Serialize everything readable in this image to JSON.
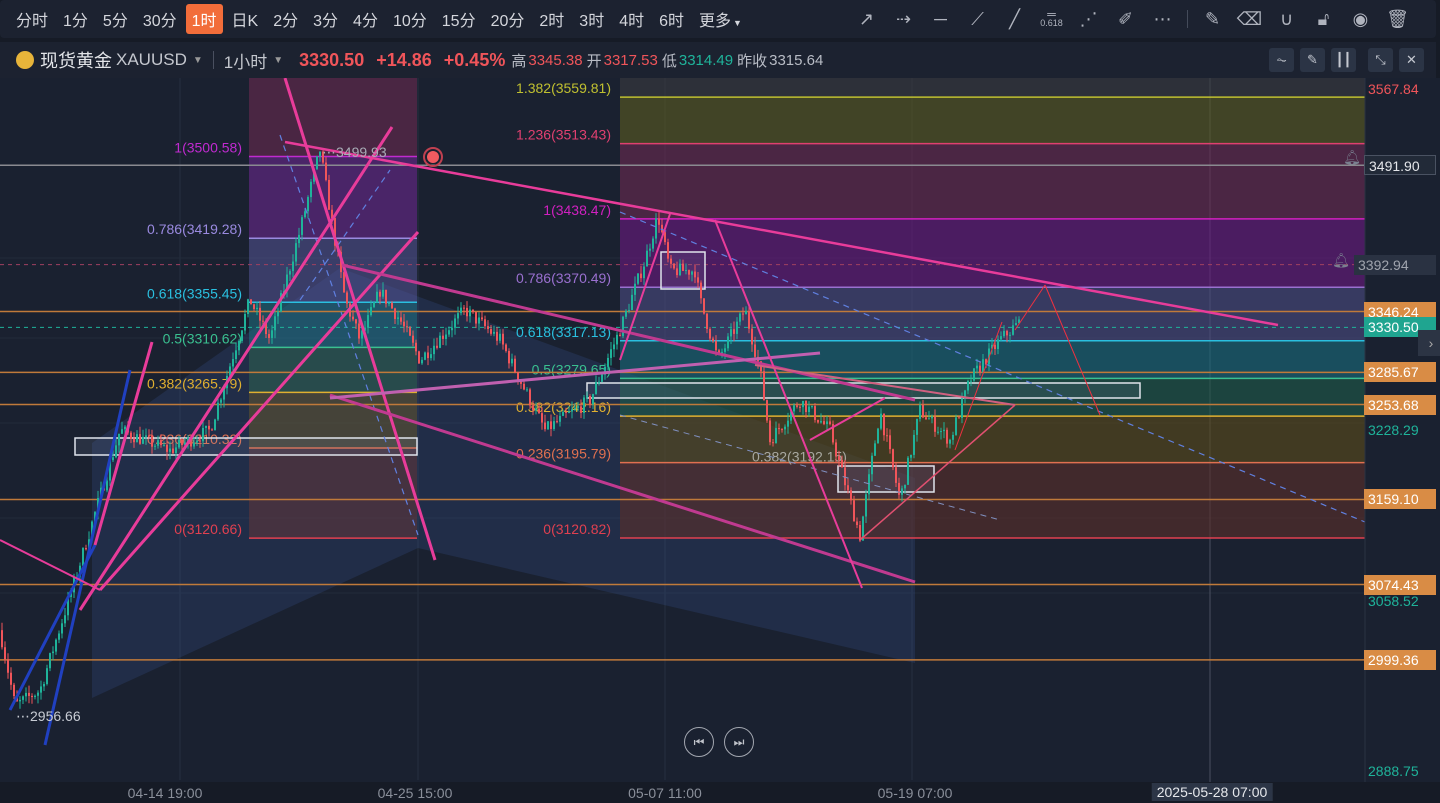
{
  "periods": [
    "分时",
    "1分",
    "5分",
    "30分",
    "1时",
    "日K",
    "2分",
    "3分",
    "4分",
    "10分",
    "15分",
    "20分",
    "2时",
    "3时",
    "4时",
    "6时",
    "更多"
  ],
  "active_period": "1时",
  "tools": [
    "trend-arrow",
    "dashed-arrow",
    "horizontal-line",
    "ray",
    "segment",
    "fib-0.618",
    "fan",
    "highlighter",
    "more",
    "edit",
    "eraser",
    "magnet",
    "unlock",
    "visibility",
    "trash"
  ],
  "fib_tool_label": "0.618",
  "symbol": {
    "name": "现货黄金",
    "code": "XAUUSD",
    "interval": "1小时",
    "price": "3330.50",
    "change": "+14.86",
    "change_pct": "+0.45%",
    "high_label": "高",
    "high": "3345.38",
    "open_label": "开",
    "open": "3317.53",
    "low_label": "低",
    "low": "3314.49",
    "prev_label": "昨收",
    "prev": "3315.64"
  },
  "colors": {
    "up": "#1fb39a",
    "down": "#f0555a",
    "accent": "#f26d3a",
    "level": "#d98c45"
  },
  "chart_data": {
    "type": "candlestick",
    "price_axis": [
      {
        "v": "3567.84",
        "p": 3567.84,
        "style": "red"
      },
      {
        "v": "3491.90",
        "p": 3491.9,
        "style": "alert"
      },
      {
        "v": "3392.94",
        "p": 3392.94,
        "style": "alert-gray"
      },
      {
        "v": "3346.24",
        "p": 3346.24,
        "style": "box"
      },
      {
        "v": "3330.50",
        "p": 3330.5,
        "style": "current"
      },
      {
        "v": "3285.67",
        "p": 3285.67,
        "style": "box"
      },
      {
        "v": "3253.68",
        "p": 3253.68,
        "style": "box"
      },
      {
        "v": "3228.29",
        "p": 3228.29,
        "style": "green"
      },
      {
        "v": "3159.10",
        "p": 3159.1,
        "style": "box"
      },
      {
        "v": "3074.43",
        "p": 3074.43,
        "style": "box"
      },
      {
        "v": "3058.52",
        "p": 3058.52,
        "style": "green"
      },
      {
        "v": "2999.36",
        "p": 2999.36,
        "style": "box"
      },
      {
        "v": "2888.75",
        "p": 2888.75,
        "style": "green"
      }
    ],
    "time_labels": [
      "04-14 19:00",
      "04-25 15:00",
      "05-07 11:00",
      "05-19 07:00"
    ],
    "crosshair_time": "2025-05-28 07:00",
    "fib1": [
      {
        "t": "1(3500.58)",
        "p": 3500.58
      },
      {
        "t": "0.786(3419.28)",
        "p": 3419.28
      },
      {
        "t": "0.618(3355.45)",
        "p": 3355.45
      },
      {
        "t": "0.5(3310.62)",
        "p": 3310.62
      },
      {
        "t": "0.382(3265.79)",
        "p": 3265.79
      },
      {
        "t": "0.236(3210.32)",
        "p": 3210.32
      },
      {
        "t": "0(3120.66)",
        "p": 3120.66
      }
    ],
    "fib2": [
      {
        "t": "1.382(3559.81)",
        "p": 3559.81
      },
      {
        "t": "1.236(3513.43)",
        "p": 3513.43
      },
      {
        "t": "1(3438.47)",
        "p": 3438.47
      },
      {
        "t": "0.786(3370.49)",
        "p": 3370.49
      },
      {
        "t": "0.618(3317.13)",
        "p": 3317.13
      },
      {
        "t": "0.5(3279.65)",
        "p": 3279.65
      },
      {
        "t": "0.382(3242.16)",
        "p": 3242.16
      },
      {
        "t": "0.236(3195.79)",
        "p": 3195.79
      },
      {
        "t": "0(3120.82)",
        "p": 3120.82
      }
    ],
    "extra_fib_label": "0.382(3192.15)",
    "high_marker": "3499.93",
    "low_marker": "2956.66"
  }
}
